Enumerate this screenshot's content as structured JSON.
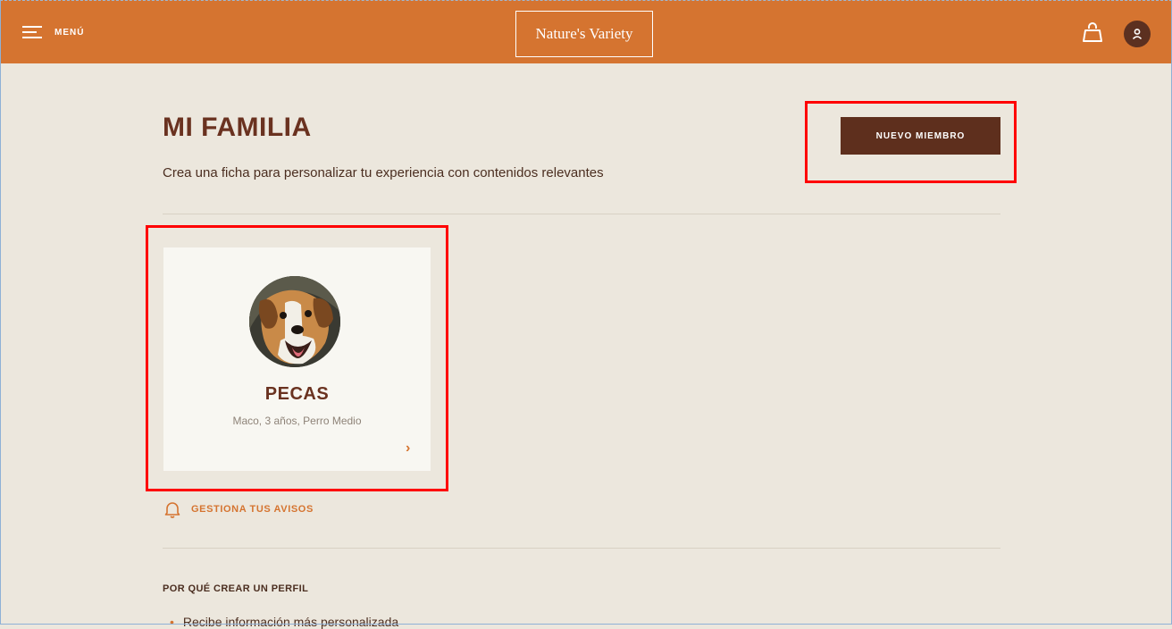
{
  "header": {
    "menu_label": "MENÚ",
    "logo_text": "Nature's Variety",
    "icons": [
      "hamburger-icon",
      "shopping-bag-icon",
      "user-icon"
    ],
    "brand_color": "#d57430"
  },
  "main": {
    "title": "MI FAMILIA",
    "subtitle": "Crea una ficha para personalizar tu experiencia con contenidos relevantes",
    "new_member_label": "NUEVO MIEMBRO"
  },
  "pets": [
    {
      "name": "PECAS",
      "info": "Maco, 3 años, Perro Medio"
    }
  ],
  "alerts_label": "GESTIONA TUS AVISOS",
  "why_title": "POR QUÉ CREAR UN PERFIL",
  "why_first": "Recibe información más personalizada",
  "colors": {
    "dark_brown": "#5e2f1d",
    "highlight": "#ff0000",
    "background": "#ece7dd"
  }
}
